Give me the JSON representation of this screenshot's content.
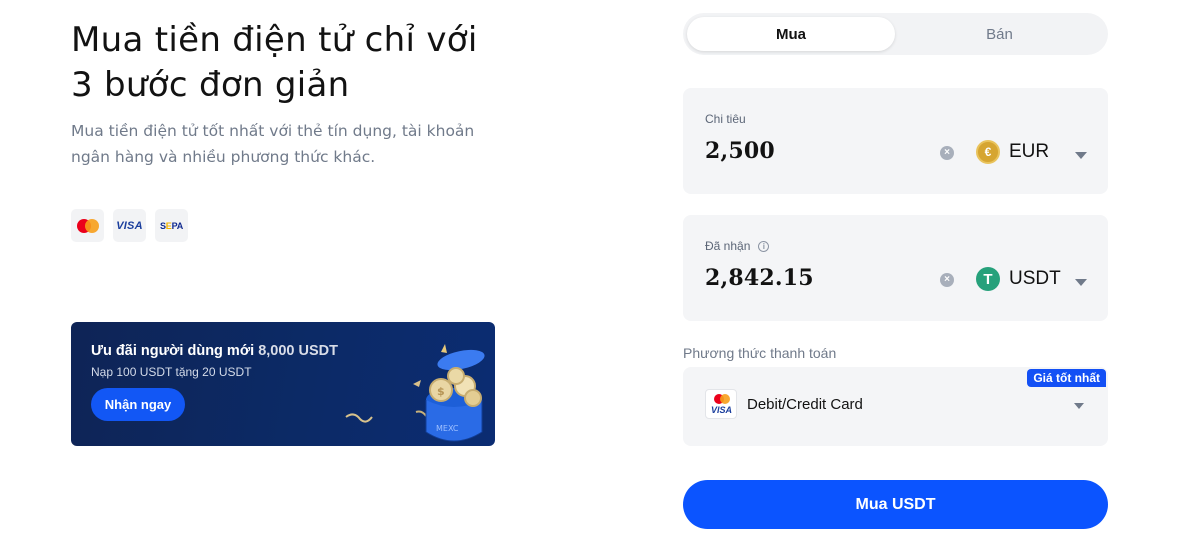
{
  "hero": {
    "title_line1": "Mua tiền điện tử chỉ với",
    "title_line2": "3 bước đơn giản",
    "subtitle_line1": "Mua tiền điện tử tốt nhất với thẻ tín dụng, tài khoản",
    "subtitle_line2": "ngân hàng và nhiều phương thức khác."
  },
  "payment_methods": [
    {
      "icon": "mastercard-icon",
      "label": ""
    },
    {
      "icon": "visa-icon",
      "label": "VISA"
    },
    {
      "icon": "sepa-icon",
      "label": "SEPA"
    }
  ],
  "promo": {
    "title_prefix": "Ưu đãi người dùng mới",
    "title_amount": "8,000 USDT",
    "subtitle": "Nạp 100 USDT tặng 20 USDT",
    "button": "Nhận ngay",
    "art_label": "MEXC"
  },
  "trade_tabs": {
    "buy": "Mua",
    "sell": "Bán",
    "active": "buy"
  },
  "spend": {
    "label": "Chi tiêu",
    "value": "2,500",
    "currency": "EUR",
    "currency_symbol": "€",
    "currency_color": "#d6a531"
  },
  "receive": {
    "label": "Đã nhận",
    "info_icon": "i",
    "value": "2,842.15",
    "currency": "USDT",
    "currency_symbol": "T",
    "currency_color": "#26a17b"
  },
  "payment": {
    "label": "Phương thức thanh toán",
    "badge": "Giá tốt nhất",
    "method": "Debit/Credit Card",
    "icon_text": "VISA"
  },
  "submit": {
    "label": "Mua USDT"
  },
  "colors": {
    "accent": "#0b54ff",
    "promo_bg": "#0c2a66"
  }
}
